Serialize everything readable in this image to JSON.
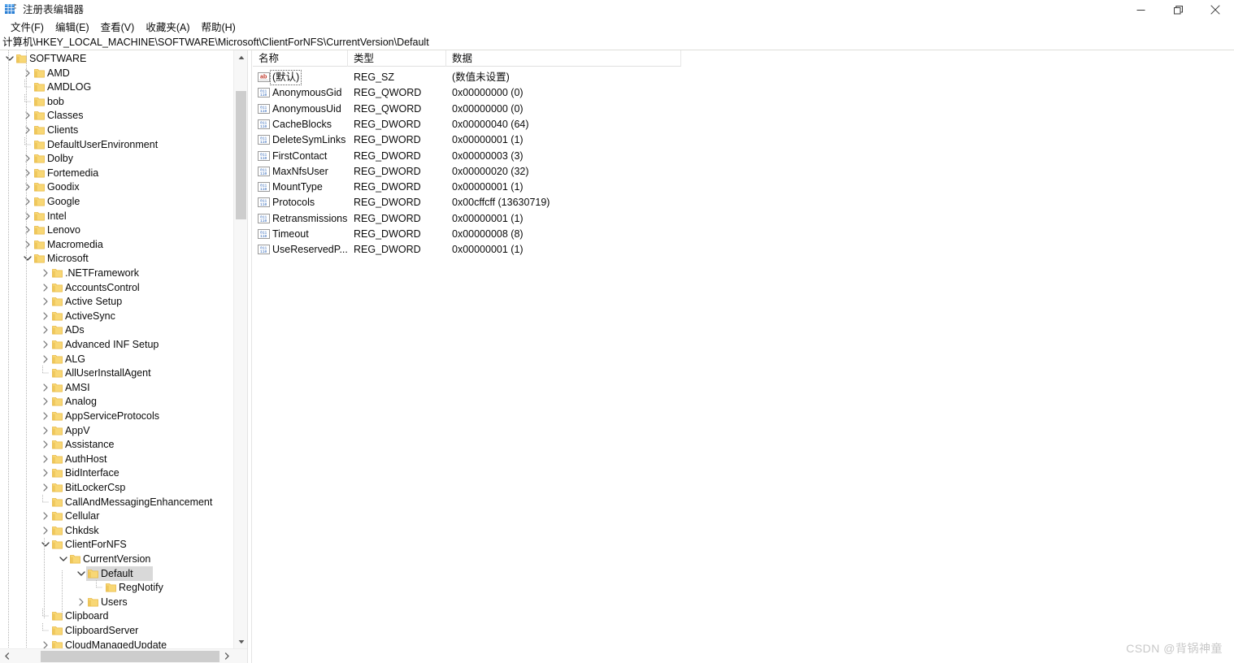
{
  "window": {
    "title": "注册表编辑器",
    "icon": "registry-editor-icon",
    "minimize_label": "—",
    "maximize_label": "❐",
    "close_label": "✕"
  },
  "menubar": {
    "items": [
      {
        "label": "文件(F)",
        "name": "menu-file"
      },
      {
        "label": "编辑(E)",
        "name": "menu-edit"
      },
      {
        "label": "查看(V)",
        "name": "menu-view"
      },
      {
        "label": "收藏夹(A)",
        "name": "menu-favorites"
      },
      {
        "label": "帮助(H)",
        "name": "menu-help"
      }
    ]
  },
  "address": {
    "path": "计算机\\HKEY_LOCAL_MACHINE\\SOFTWARE\\Microsoft\\ClientForNFS\\CurrentVersion\\Default"
  },
  "tree": {
    "selected": "Default",
    "nodes": [
      {
        "label": "SOFTWARE",
        "depth": 0,
        "state": "expanded"
      },
      {
        "label": "AMD",
        "depth": 1,
        "state": "collapsed"
      },
      {
        "label": "AMDLOG",
        "depth": 1,
        "state": "leaf"
      },
      {
        "label": "bob",
        "depth": 1,
        "state": "leaf"
      },
      {
        "label": "Classes",
        "depth": 1,
        "state": "collapsed"
      },
      {
        "label": "Clients",
        "depth": 1,
        "state": "collapsed"
      },
      {
        "label": "DefaultUserEnvironment",
        "depth": 1,
        "state": "leaf"
      },
      {
        "label": "Dolby",
        "depth": 1,
        "state": "collapsed"
      },
      {
        "label": "Fortemedia",
        "depth": 1,
        "state": "collapsed"
      },
      {
        "label": "Goodix",
        "depth": 1,
        "state": "collapsed"
      },
      {
        "label": "Google",
        "depth": 1,
        "state": "collapsed"
      },
      {
        "label": "Intel",
        "depth": 1,
        "state": "collapsed"
      },
      {
        "label": "Lenovo",
        "depth": 1,
        "state": "collapsed"
      },
      {
        "label": "Macromedia",
        "depth": 1,
        "state": "collapsed"
      },
      {
        "label": "Microsoft",
        "depth": 1,
        "state": "expanded"
      },
      {
        "label": ".NETFramework",
        "depth": 2,
        "state": "collapsed"
      },
      {
        "label": "AccountsControl",
        "depth": 2,
        "state": "collapsed"
      },
      {
        "label": "Active Setup",
        "depth": 2,
        "state": "collapsed"
      },
      {
        "label": "ActiveSync",
        "depth": 2,
        "state": "collapsed"
      },
      {
        "label": "ADs",
        "depth": 2,
        "state": "collapsed"
      },
      {
        "label": "Advanced INF Setup",
        "depth": 2,
        "state": "collapsed"
      },
      {
        "label": "ALG",
        "depth": 2,
        "state": "collapsed"
      },
      {
        "label": "AllUserInstallAgent",
        "depth": 2,
        "state": "leaf"
      },
      {
        "label": "AMSI",
        "depth": 2,
        "state": "collapsed"
      },
      {
        "label": "Analog",
        "depth": 2,
        "state": "collapsed"
      },
      {
        "label": "AppServiceProtocols",
        "depth": 2,
        "state": "collapsed"
      },
      {
        "label": "AppV",
        "depth": 2,
        "state": "collapsed"
      },
      {
        "label": "Assistance",
        "depth": 2,
        "state": "collapsed"
      },
      {
        "label": "AuthHost",
        "depth": 2,
        "state": "collapsed"
      },
      {
        "label": "BidInterface",
        "depth": 2,
        "state": "collapsed"
      },
      {
        "label": "BitLockerCsp",
        "depth": 2,
        "state": "collapsed"
      },
      {
        "label": "CallAndMessagingEnhancement",
        "depth": 2,
        "state": "leaf"
      },
      {
        "label": "Cellular",
        "depth": 2,
        "state": "collapsed"
      },
      {
        "label": "Chkdsk",
        "depth": 2,
        "state": "collapsed"
      },
      {
        "label": "ClientForNFS",
        "depth": 2,
        "state": "expanded"
      },
      {
        "label": "CurrentVersion",
        "depth": 3,
        "state": "expanded"
      },
      {
        "label": "Default",
        "depth": 4,
        "state": "expanded",
        "selected": true
      },
      {
        "label": "RegNotify",
        "depth": 5,
        "state": "leaf"
      },
      {
        "label": "Users",
        "depth": 4,
        "state": "collapsed"
      },
      {
        "label": "Clipboard",
        "depth": 2,
        "state": "leaf"
      },
      {
        "label": "ClipboardServer",
        "depth": 2,
        "state": "leaf"
      },
      {
        "label": "CloudManagedUpdate",
        "depth": 2,
        "state": "collapsed"
      }
    ]
  },
  "list": {
    "columns": [
      {
        "label": "名称",
        "name": "column-name"
      },
      {
        "label": "类型",
        "name": "column-type"
      },
      {
        "label": "数据",
        "name": "column-data"
      }
    ],
    "rows": [
      {
        "name": "(默认)",
        "type": "REG_SZ",
        "data": "(数值未设置)",
        "icon": "string-value-icon",
        "focused": true
      },
      {
        "name": "AnonymousGid",
        "type": "REG_QWORD",
        "data": "0x00000000 (0)",
        "icon": "binary-value-icon"
      },
      {
        "name": "AnonymousUid",
        "type": "REG_QWORD",
        "data": "0x00000000 (0)",
        "icon": "binary-value-icon"
      },
      {
        "name": "CacheBlocks",
        "type": "REG_DWORD",
        "data": "0x00000040 (64)",
        "icon": "binary-value-icon"
      },
      {
        "name": "DeleteSymLinks",
        "type": "REG_DWORD",
        "data": "0x00000001 (1)",
        "icon": "binary-value-icon"
      },
      {
        "name": "FirstContact",
        "type": "REG_DWORD",
        "data": "0x00000003 (3)",
        "icon": "binary-value-icon"
      },
      {
        "name": "MaxNfsUser",
        "type": "REG_DWORD",
        "data": "0x00000020 (32)",
        "icon": "binary-value-icon"
      },
      {
        "name": "MountType",
        "type": "REG_DWORD",
        "data": "0x00000001 (1)",
        "icon": "binary-value-icon"
      },
      {
        "name": "Protocols",
        "type": "REG_DWORD",
        "data": "0x00cffcff (13630719)",
        "icon": "binary-value-icon"
      },
      {
        "name": "Retransmissions",
        "type": "REG_DWORD",
        "data": "0x00000001 (1)",
        "icon": "binary-value-icon"
      },
      {
        "name": "Timeout",
        "type": "REG_DWORD",
        "data": "0x00000008 (8)",
        "icon": "binary-value-icon"
      },
      {
        "name": "UseReservedP...",
        "type": "REG_DWORD",
        "data": "0x00000001 (1)",
        "icon": "binary-value-icon"
      }
    ]
  },
  "watermark": {
    "text": "CSDN @背锅神童"
  },
  "colors": {
    "selection": "#d9d9d9",
    "folder": "#f8d775",
    "folder_dark": "#e8b945",
    "string_icon": "#c0392b",
    "binary_icon": "#2a63b8",
    "watermark": "#c8c8c8"
  }
}
